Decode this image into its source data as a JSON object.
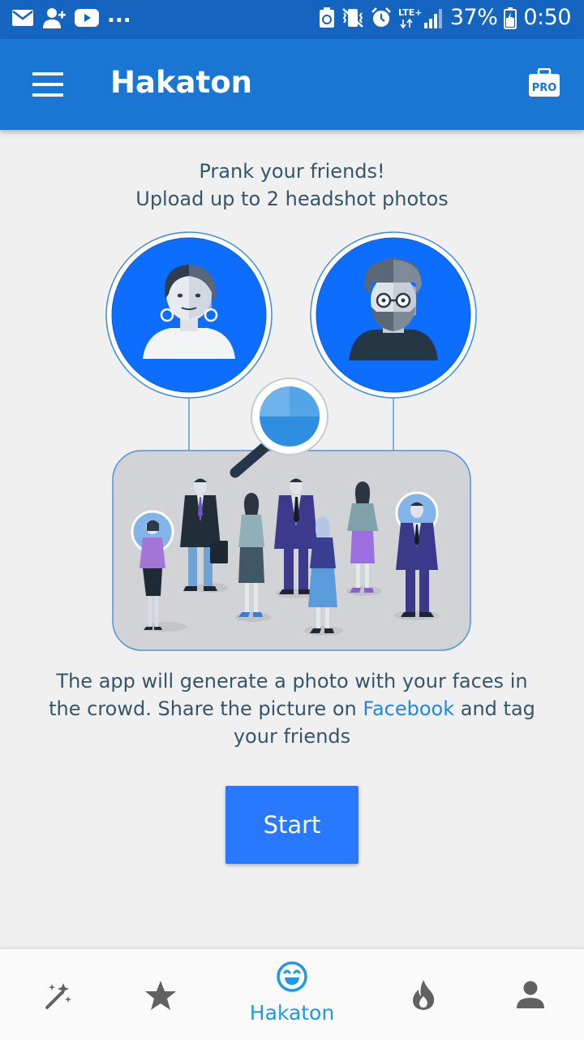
{
  "status_bar": {
    "battery": "37%",
    "time": "0:50",
    "network": "LTE+",
    "overflow": "...",
    "icons": [
      "mail-icon",
      "add-contact-icon",
      "youtube-icon",
      "recycle-icon",
      "vibrate-icon",
      "alarm-icon",
      "signal-icon",
      "battery-icon"
    ]
  },
  "app_bar": {
    "title": "Hakaton",
    "menu_icon": "hamburger-menu-icon",
    "pro_badge": "PRO"
  },
  "intro": {
    "line1": "Prank your friends!",
    "line2": "Upload up to 2 headshot photos"
  },
  "description": {
    "part1": "The app will generate a photo with your faces in the crowd. Share the picture on ",
    "link": "Facebook",
    "part2": " and tag your friends"
  },
  "start_button": {
    "label": "Start"
  },
  "bottom_nav": {
    "items": [
      {
        "icon": "magic-wand-icon",
        "label": ""
      },
      {
        "icon": "star-icon",
        "label": ""
      },
      {
        "icon": "smiley-icon",
        "label": "Hakaton",
        "active": true
      },
      {
        "icon": "flame-icon",
        "label": ""
      },
      {
        "icon": "person-icon",
        "label": ""
      }
    ]
  },
  "colors": {
    "status_bar": "#1565c0",
    "app_bar": "#1976d2",
    "accent": "#2979ff",
    "text": "#35556b",
    "link": "#1e88e5",
    "nav_active": "#1e9be0",
    "nav_inactive": "#616161"
  }
}
